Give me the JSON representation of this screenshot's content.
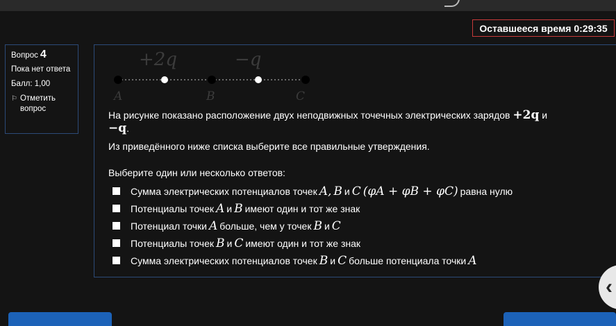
{
  "timer": {
    "text": "Оставшееся время 0:29:35"
  },
  "info": {
    "question_label": "Вопрос",
    "question_number": "4",
    "state": "Пока нет ответа",
    "grade": "Балл: 1,00",
    "flag_label": "Отметить вопрос"
  },
  "figure": {
    "charge1": "+2q",
    "charge2": "−q",
    "point_a": "A",
    "point_b": "B",
    "point_c": "C"
  },
  "question": {
    "text_part1": "На рисунке показано расположение двух неподвижных точечных электрических зарядов",
    "charge_pos": "+2q",
    "and": "и",
    "charge_neg": "−q",
    "dot": ".",
    "text_part2": "Из приведённого ниже списка выберите все правильные утверждения."
  },
  "prompt": "Выберите один или несколько ответов:",
  "options": [
    {
      "pre": "Сумма электрических потенциалов точек",
      "m1": "A,",
      "m2": "B",
      "mid": "и",
      "m3": "C",
      "m4": "(φA + φB + φC)",
      "post": "равна нулю"
    },
    {
      "pre": "Потенциалы точек",
      "m1": "A",
      "mid": "и",
      "m2": "B",
      "post": "имеют один и тот же знак"
    },
    {
      "pre": "Потенциал точки",
      "m1": "A",
      "mid": "больше, чем у точек",
      "m2": "B",
      "mid2": "и",
      "m3": "C"
    },
    {
      "pre": "Потенциалы точек",
      "m1": "B",
      "mid": "и",
      "m2": "C",
      "post": "имеют один и тот же знак"
    },
    {
      "pre": "Сумма электрических потенциалов точек",
      "m1": "B",
      "mid": "и",
      "m2": "C",
      "post": "больше потенциала точки",
      "m3": "A"
    }
  ],
  "nav": {
    "chevron": "‹"
  }
}
